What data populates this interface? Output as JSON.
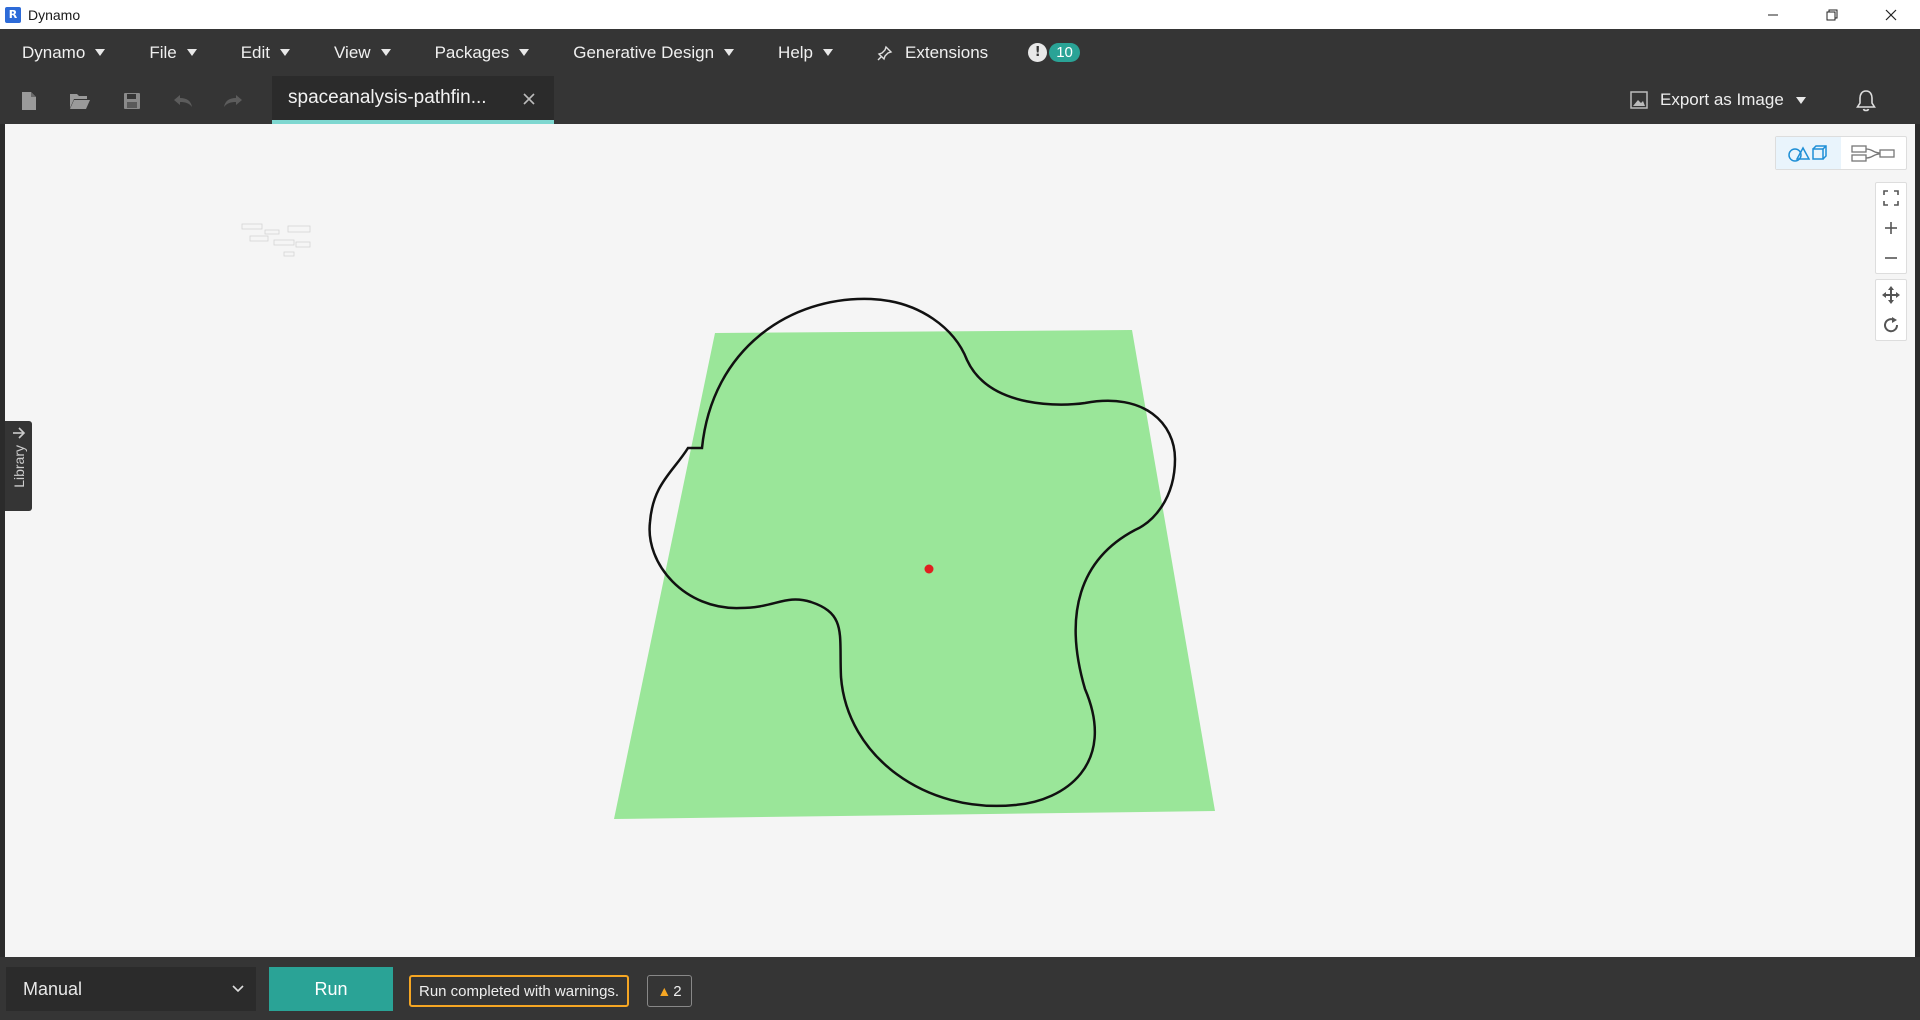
{
  "window": {
    "title": "Dynamo",
    "app_logo_letter": "R"
  },
  "menu": {
    "items": [
      {
        "label": "Dynamo"
      },
      {
        "label": "File"
      },
      {
        "label": "Edit"
      },
      {
        "label": "View"
      },
      {
        "label": "Packages"
      },
      {
        "label": "Generative Design"
      },
      {
        "label": "Help"
      }
    ],
    "extensions_label": "Extensions",
    "notification_mark": "!",
    "notification_count": "10"
  },
  "toolbar": {
    "tab_title": "spaceanalysis-pathfin...",
    "export_label": "Export as Image"
  },
  "canvas": {
    "library_label": "Library",
    "plane_color": "#9ae699",
    "curve_color": "#111111",
    "point_color": "#e02020",
    "view_mode": "3d-background-preview"
  },
  "bottom": {
    "run_mode": "Manual",
    "run_label": "Run",
    "status_message": "Run completed with warnings.",
    "warning_count": "2"
  },
  "colors": {
    "accent": "#2aa396",
    "warning": "#f5a623",
    "tab_underline": "#7ed7d0"
  }
}
